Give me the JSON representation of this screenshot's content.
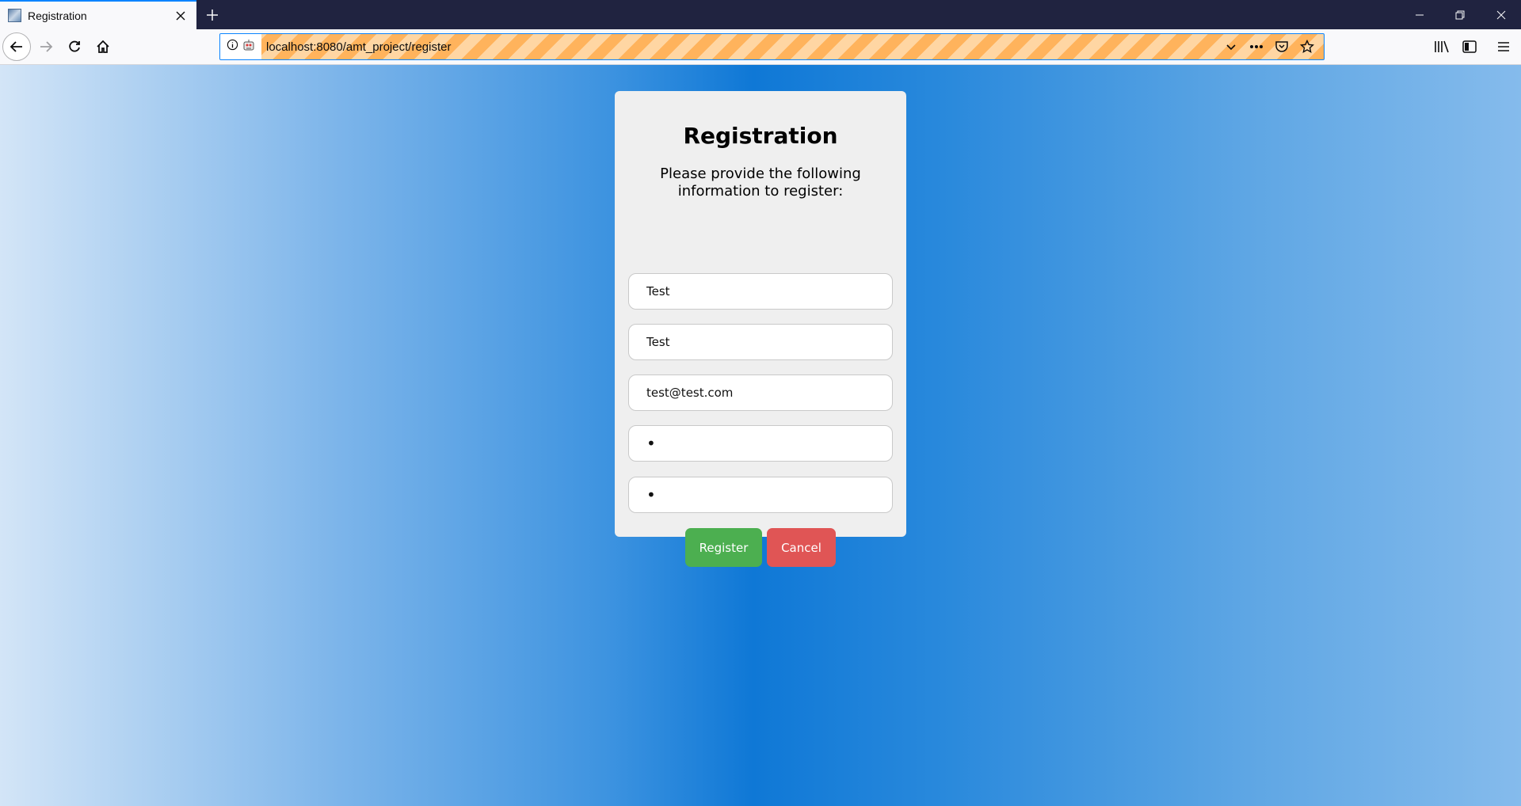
{
  "browser": {
    "tab": {
      "title": "Registration"
    },
    "url": "localhost:8080/amt_project/register"
  },
  "form": {
    "title": "Registration",
    "instructions": "Please provide the following information to register:",
    "fields": [
      {
        "name": "first-name",
        "value": "Test"
      },
      {
        "name": "last-name",
        "value": "Test"
      },
      {
        "name": "email",
        "value": "test@test.com"
      },
      {
        "name": "password",
        "value": "•"
      },
      {
        "name": "password-confirm",
        "value": "•"
      }
    ],
    "register_label": "Register",
    "cancel_label": "Cancel"
  },
  "colors": {
    "register": "#4caf50",
    "cancel": "#e05555",
    "background_center": "#0f78d6"
  }
}
